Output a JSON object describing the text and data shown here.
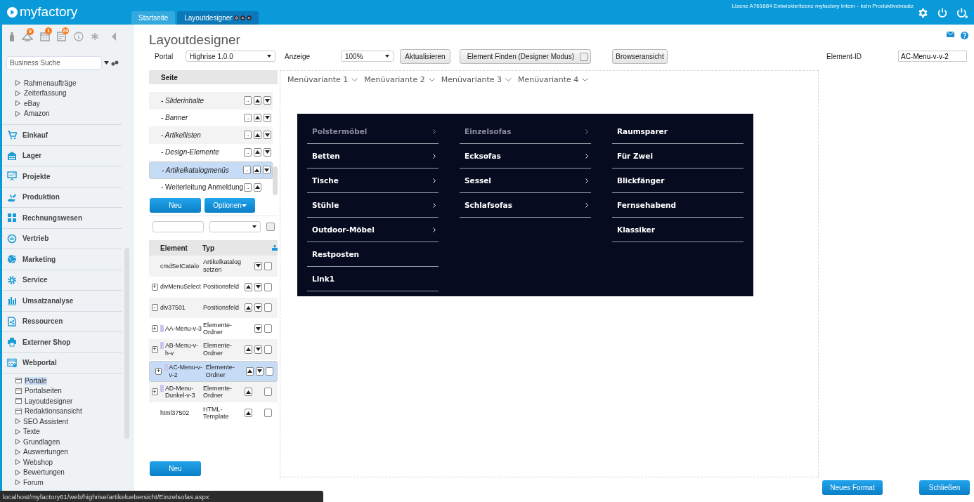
{
  "header": {
    "logo": "myfactory",
    "tabs": [
      {
        "label": "Startseite",
        "selected": false
      },
      {
        "label": "Layoutdesigner",
        "selected": true
      }
    ],
    "license": "Lizenz A761684 Entwicklerlizenz myfactory Intern - kein Produktiveinsatz"
  },
  "sidebar": {
    "badges": [
      "9",
      "1",
      "24"
    ],
    "search": {
      "placeholder": "Business Suche"
    },
    "tree_items": [
      "Rahmenaufträge",
      "Zeiterfassung",
      "eBay",
      "Amazon"
    ],
    "modules": [
      "Einkauf",
      "Lager",
      "Projekte",
      "Produktion",
      "Rechnungswesen",
      "Vertrieb",
      "Marketing",
      "Service",
      "Umsatzanalyse",
      "Ressourcen",
      "Externer Shop",
      "Webportal"
    ],
    "sub_items": [
      {
        "label": "Portale",
        "kind": "page",
        "selected": true
      },
      {
        "label": "Portalseiten",
        "kind": "page",
        "selected": false
      },
      {
        "label": "Layoutdesigner",
        "kind": "page",
        "selected": false
      },
      {
        "label": "Redaktionsansicht",
        "kind": "page",
        "selected": false
      },
      {
        "label": "SEO Assistent",
        "kind": "folder",
        "selected": false
      },
      {
        "label": "Texte",
        "kind": "folder",
        "selected": false
      },
      {
        "label": "Grundlagen",
        "kind": "folder",
        "selected": false
      },
      {
        "label": "Auswertungen",
        "kind": "folder",
        "selected": false
      },
      {
        "label": "Webshop",
        "kind": "folder",
        "selected": false
      },
      {
        "label": "Bewertungen",
        "kind": "folder",
        "selected": false
      },
      {
        "label": "Forum",
        "kind": "folder",
        "selected": false
      }
    ]
  },
  "designer": {
    "title": "Layoutdesigner",
    "portal": {
      "label": "Portal",
      "value": "Highrise 1.0.0"
    },
    "display": {
      "label": "Anzeige",
      "value": "100%"
    },
    "refresh_button": "Aktualisieren",
    "find_button": {
      "label": "Element Finden (Designer Modus)",
      "checked": false
    },
    "browser_button": "Browseransicht",
    "pages": {
      "header": "Seite",
      "rows": [
        {
          "label": "- Sliderinhalte",
          "kind": "section",
          "more": "..",
          "up": true,
          "down": true,
          "selected": false
        },
        {
          "label": "- Banner",
          "kind": "section",
          "more": "..",
          "up": true,
          "down": true,
          "selected": false
        },
        {
          "label": "- Artikellisten",
          "kind": "section",
          "more": "..",
          "up": true,
          "down": true,
          "selected": false
        },
        {
          "label": "- Design-Elemente",
          "kind": "section",
          "more": "..",
          "up": true,
          "down": true,
          "selected": false
        },
        {
          "label": "- Artikelkatalogmenüs",
          "kind": "section",
          "more": "..",
          "up": true,
          "down": true,
          "selected": true
        },
        {
          "label": "- Weiterleitung Anmeldung",
          "kind": "page",
          "more": "..",
          "up": true,
          "down": false,
          "selected": false
        }
      ]
    },
    "new_button": "Neu",
    "options_button": "Optionen",
    "elements": {
      "columns": [
        "Element",
        "Typ"
      ],
      "rows": [
        {
          "element": "cmdSetCatalo",
          "type": "Artikelkatalog setzen",
          "marker": false,
          "up": false,
          "down": true,
          "selected": false
        },
        {
          "expander": "+",
          "element": "divMenuSelect",
          "type": "Positionsfeld",
          "marker": false,
          "up": true,
          "down": true,
          "selected": false
        },
        {
          "expander": "-",
          "element": "div37501",
          "type": "Positionsfeld",
          "marker": false,
          "up": true,
          "down": true,
          "selected": false
        },
        {
          "expander": "+",
          "element": "AA-Menu-v-3",
          "type": "Elemente-Ordner",
          "marker": true,
          "up": false,
          "down": true,
          "selected": false
        },
        {
          "expander": "+",
          "element": "AB-Menu-v-h-v",
          "type": "Elemente-Ordner",
          "marker": true,
          "up": true,
          "down": true,
          "selected": false
        },
        {
          "expander": "+",
          "element": "AC-Menu-v-v-2",
          "type": "Elemente-Ordner",
          "marker": true,
          "up": true,
          "down": true,
          "selected": true
        },
        {
          "expander": "+",
          "element": "AD-Menu-Dunkel-v-3",
          "type": "Elemente-Ordner",
          "marker": true,
          "up": true,
          "down": false,
          "selected": false
        },
        {
          "element": "html37502",
          "type": "HTML-Template",
          "marker": false,
          "up": true,
          "down": false,
          "selected": false
        }
      ]
    },
    "filter_checkbox": {
      "checked": false
    },
    "bottom_new_button": "Neu"
  },
  "canvas": {
    "menu": [
      "Menüvariante 1",
      "Menüvariante 2",
      "Menüvariante 3",
      "Menüvariante 4"
    ],
    "mega_menu": [
      [
        {
          "label": "Polstermöbel",
          "arrow": true,
          "selected": true
        },
        {
          "label": "Betten",
          "arrow": true,
          "selected": false
        },
        {
          "label": "Tische",
          "arrow": true,
          "selected": false
        },
        {
          "label": "Stühle",
          "arrow": true,
          "selected": false
        },
        {
          "label": "Outdoor-Möbel",
          "arrow": true,
          "selected": false
        },
        {
          "label": "Restposten",
          "arrow": false,
          "selected": false
        },
        {
          "label": "Link1",
          "arrow": false,
          "selected": false
        }
      ],
      [
        {
          "label": "Einzelsofas",
          "arrow": true,
          "selected": true
        },
        {
          "label": "Ecksofas",
          "arrow": true,
          "selected": false
        },
        {
          "label": "Sessel",
          "arrow": true,
          "selected": false
        },
        {
          "label": "Schlafsofas",
          "arrow": true,
          "selected": false
        }
      ],
      [
        {
          "label": "Raumsparer",
          "arrow": false,
          "selected": false
        },
        {
          "label": "Für Zwei",
          "arrow": false,
          "selected": false
        },
        {
          "label": "Blickfänger",
          "arrow": false,
          "selected": false
        },
        {
          "label": "Fernsehabend",
          "arrow": false,
          "selected": false
        },
        {
          "label": "Klassiker",
          "arrow": false,
          "selected": false
        }
      ]
    ]
  },
  "properties": {
    "element_id": {
      "label": "Element-ID",
      "value": "AC-Menu-v-v-2"
    }
  },
  "footer": {
    "format_button": "Neues Format",
    "close_button": "Schließen"
  },
  "status_url": "localhost/myfactory61/web/highrise/artikeluebersicht/Einzelsofas.aspx"
}
